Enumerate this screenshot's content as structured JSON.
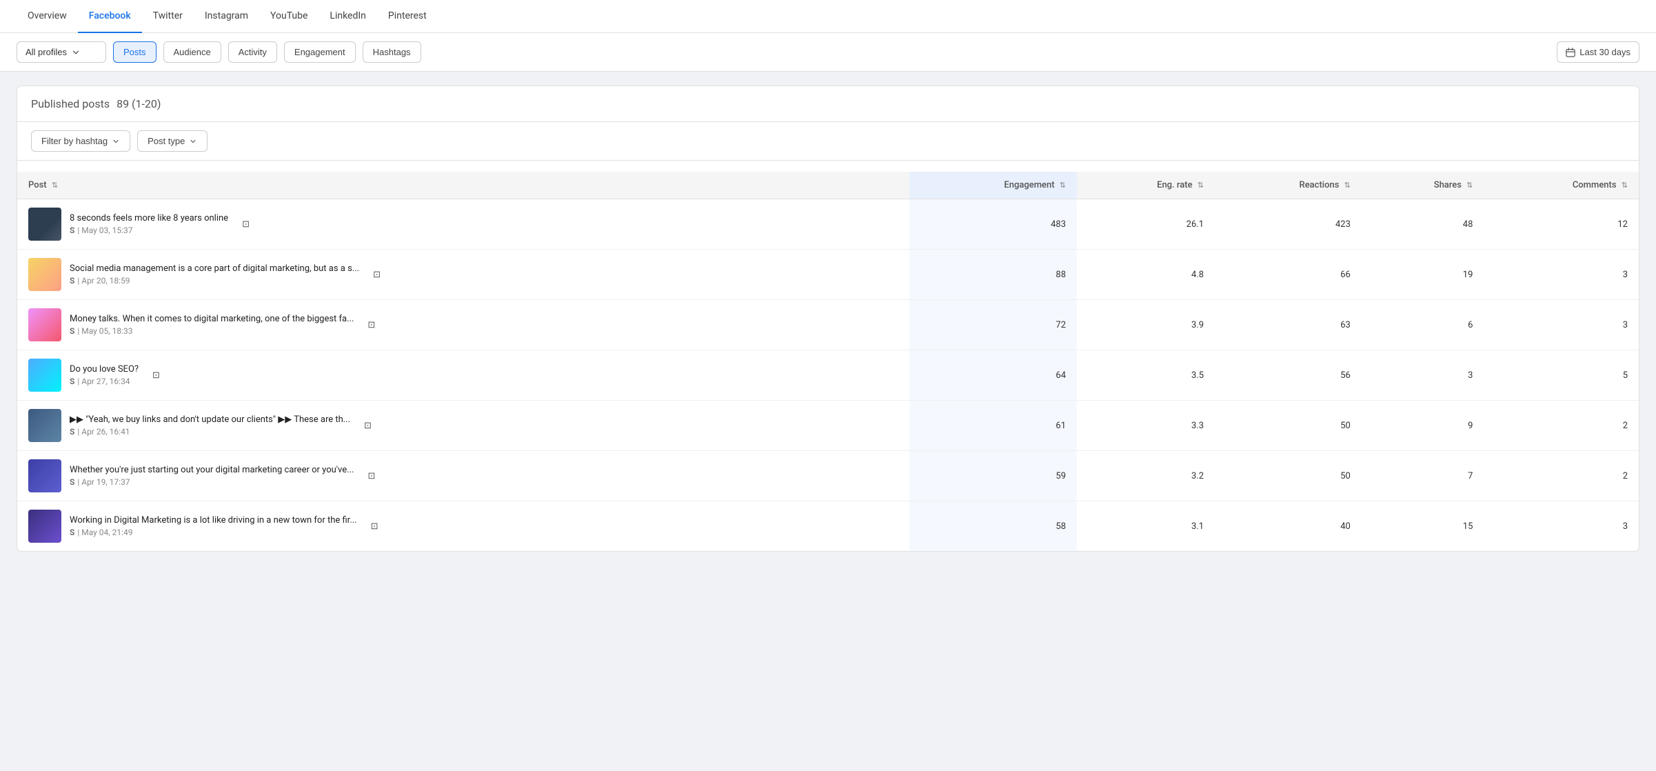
{
  "topNav": {
    "items": [
      {
        "label": "Overview",
        "active": false
      },
      {
        "label": "Facebook",
        "active": true
      },
      {
        "label": "Twitter",
        "active": false
      },
      {
        "label": "Instagram",
        "active": false
      },
      {
        "label": "YouTube",
        "active": false
      },
      {
        "label": "LinkedIn",
        "active": false
      },
      {
        "label": "Pinterest",
        "active": false
      }
    ]
  },
  "subHeader": {
    "profileDropdown": "All profiles",
    "tabs": [
      {
        "label": "Posts",
        "active": true
      },
      {
        "label": "Audience",
        "active": false
      },
      {
        "label": "Activity",
        "active": false
      },
      {
        "label": "Engagement",
        "active": false
      },
      {
        "label": "Hashtags",
        "active": false
      }
    ],
    "dateBtn": "Last 30 days"
  },
  "sectionTitle": "Published posts",
  "sectionCount": "89 (1-20)",
  "filters": [
    {
      "label": "Filter by hashtag"
    },
    {
      "label": "Post type"
    }
  ],
  "tableHeaders": [
    {
      "label": "Post",
      "sortable": true,
      "activeSort": false,
      "align": "left"
    },
    {
      "label": "Engagement",
      "sortable": true,
      "activeSort": true,
      "align": "right"
    },
    {
      "label": "Eng. rate",
      "sortable": true,
      "activeSort": false,
      "align": "right"
    },
    {
      "label": "Reactions",
      "sortable": true,
      "activeSort": false,
      "align": "right"
    },
    {
      "label": "Shares",
      "sortable": true,
      "activeSort": false,
      "align": "right"
    },
    {
      "label": "Comments",
      "sortable": true,
      "activeSort": false,
      "align": "right"
    }
  ],
  "posts": [
    {
      "id": 1,
      "title": "8 seconds feels more like 8 years online",
      "source": "S",
      "date": "May 03, 15:37",
      "thumbClass": "thumb-1",
      "engagement": 483,
      "engRate": "26.1",
      "reactions": 423,
      "shares": 48,
      "comments": 12
    },
    {
      "id": 2,
      "title": "Social media management is a core part of digital marketing, but as a s...",
      "source": "S",
      "date": "Apr 20, 18:59",
      "thumbClass": "thumb-2",
      "engagement": 88,
      "engRate": "4.8",
      "reactions": 66,
      "shares": 19,
      "comments": 3
    },
    {
      "id": 3,
      "title": "Money talks. When it comes to digital marketing, one of the biggest fa...",
      "source": "S",
      "date": "May 05, 18:33",
      "thumbClass": "thumb-3",
      "engagement": 72,
      "engRate": "3.9",
      "reactions": 63,
      "shares": 6,
      "comments": 3
    },
    {
      "id": 4,
      "title": "Do you love SEO?",
      "source": "S",
      "date": "Apr 27, 16:34",
      "thumbClass": "thumb-4",
      "engagement": 64,
      "engRate": "3.5",
      "reactions": 56,
      "shares": 3,
      "comments": 5
    },
    {
      "id": 5,
      "title": "▶▶ \"Yeah, we buy links and don't update our clients\" ▶▶ These are th...",
      "source": "S",
      "date": "Apr 26, 16:41",
      "thumbClass": "thumb-5",
      "engagement": 61,
      "engRate": "3.3",
      "reactions": 50,
      "shares": 9,
      "comments": 2
    },
    {
      "id": 6,
      "title": "Whether you're just starting out your digital marketing career or you've...",
      "source": "S",
      "date": "Apr 19, 17:37",
      "thumbClass": "thumb-6",
      "engagement": 59,
      "engRate": "3.2",
      "reactions": 50,
      "shares": 7,
      "comments": 2
    },
    {
      "id": 7,
      "title": "Working in Digital Marketing is a lot like driving in a new town for the fir...",
      "source": "S",
      "date": "May 04, 21:49",
      "thumbClass": "thumb-7",
      "engagement": 58,
      "engRate": "3.1",
      "reactions": 40,
      "shares": 15,
      "comments": 3
    }
  ]
}
